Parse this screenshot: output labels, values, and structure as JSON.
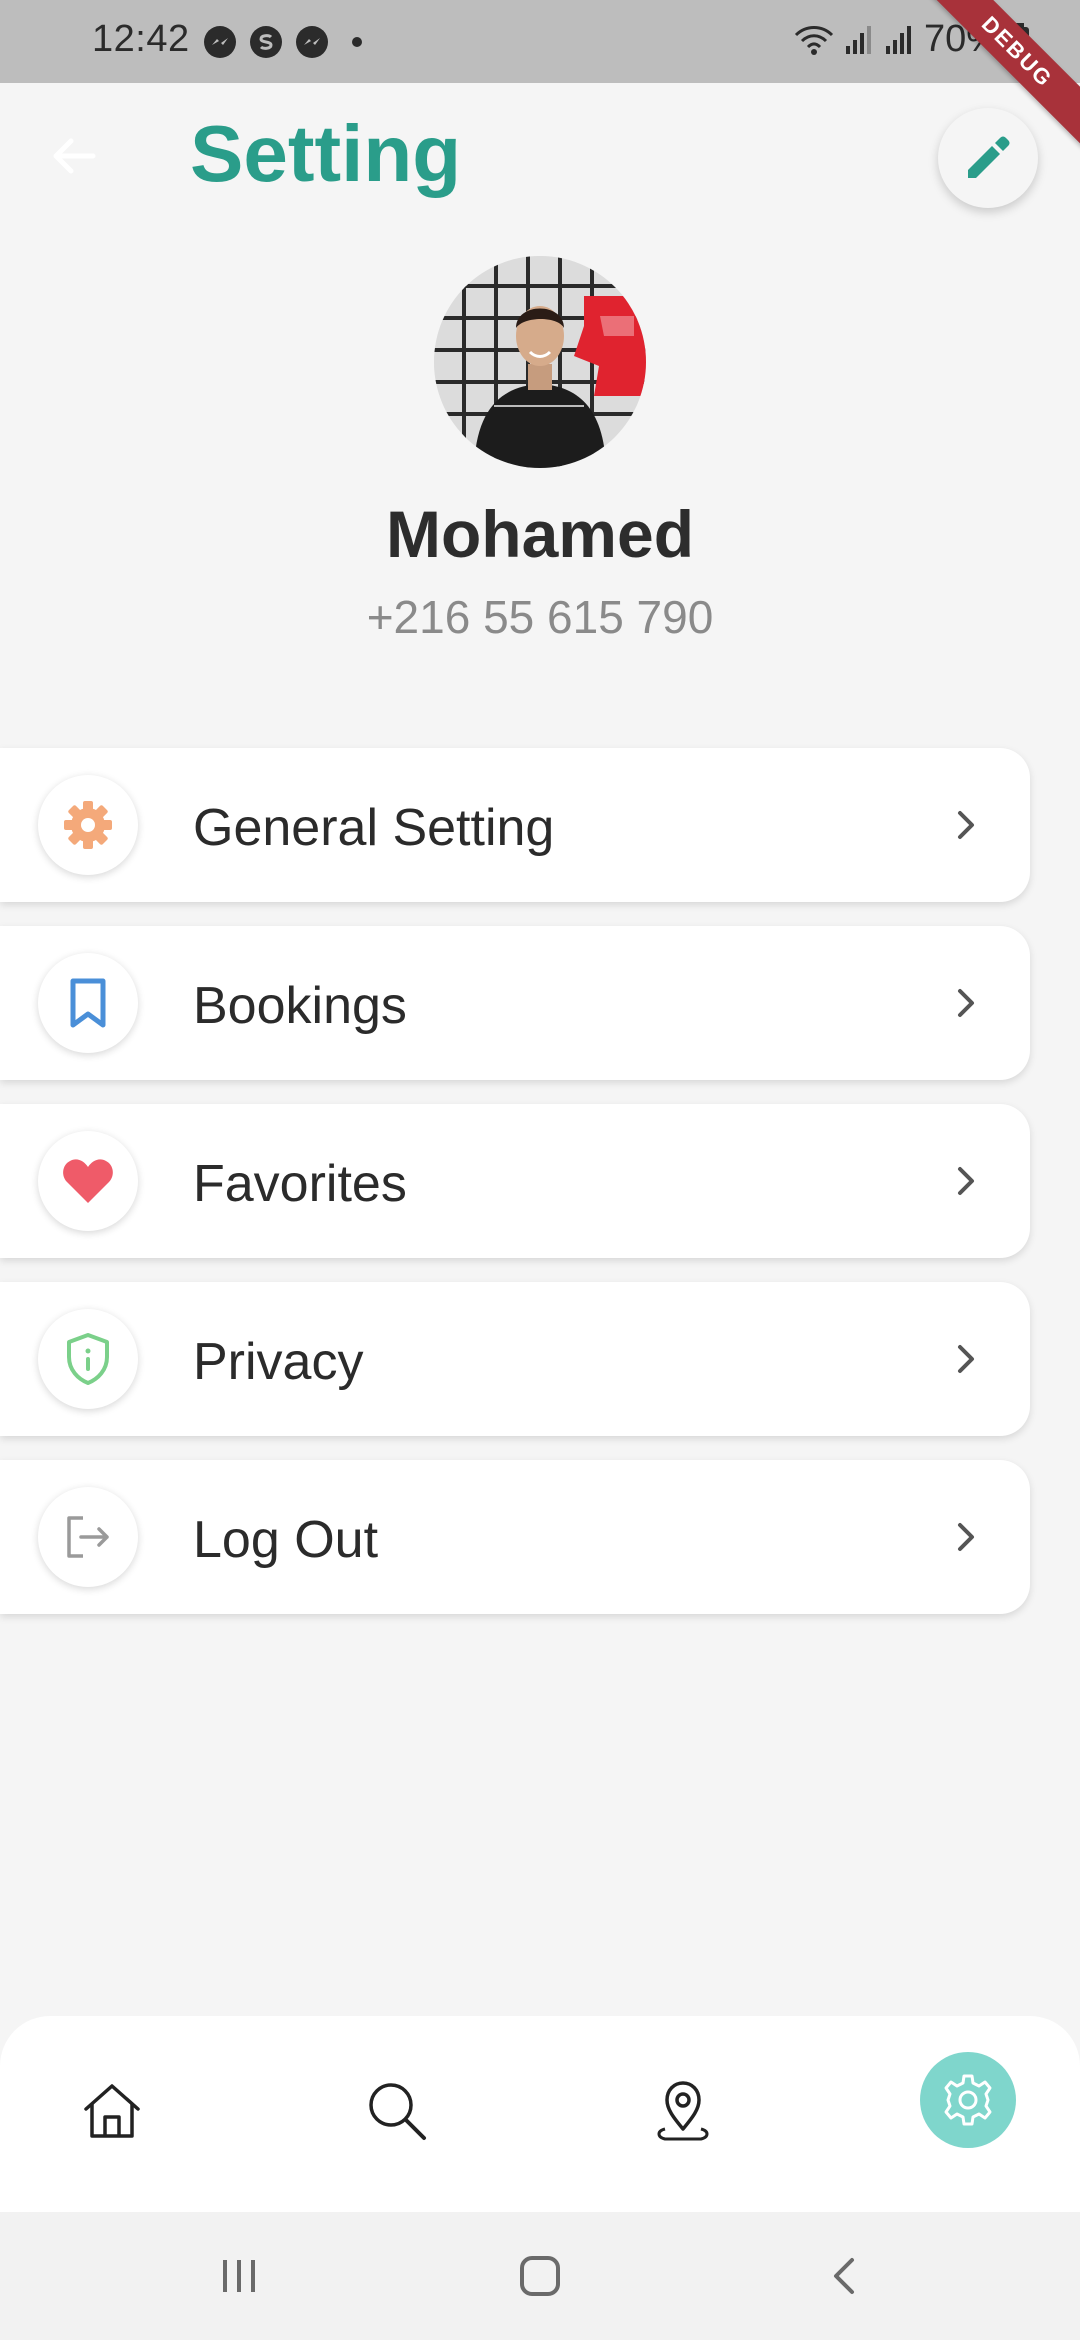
{
  "status_bar": {
    "time": "12:42",
    "battery": "70%",
    "left_icons": [
      "messenger-icon",
      "s-icon",
      "messenger-icon"
    ]
  },
  "debug_banner": "DEBUG",
  "header": {
    "title": "Setting"
  },
  "profile": {
    "name": "Mohamed",
    "phone": "+216 55 615 790"
  },
  "menu": [
    {
      "label": "General Setting",
      "icon": "gear-icon",
      "color": "#f4a97a"
    },
    {
      "label": "Bookings",
      "icon": "bookmark-icon",
      "color": "#4a8fd8"
    },
    {
      "label": "Favorites",
      "icon": "heart-icon",
      "color": "#ef5b69"
    },
    {
      "label": "Privacy",
      "icon": "shield-icon",
      "color": "#7bd08a"
    },
    {
      "label": "Log Out",
      "icon": "logout-icon",
      "color": "#9a9a9a"
    }
  ],
  "bottom_nav": [
    "home-icon",
    "search-icon",
    "location-pin-icon",
    "settings-icon"
  ],
  "colors": {
    "accent": "#2a9d8a",
    "nav_active": "#7fd6cc"
  }
}
